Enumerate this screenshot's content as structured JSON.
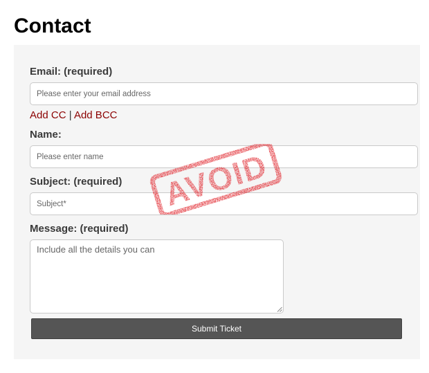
{
  "page": {
    "title": "Contact"
  },
  "form": {
    "email": {
      "label": "Email: (required)",
      "placeholder": "Please enter your email address",
      "value": ""
    },
    "cc_links": {
      "add_cc": "Add CC",
      "separator": "|",
      "add_bcc": "Add BCC"
    },
    "name": {
      "label": "Name:",
      "placeholder": "Please enter name",
      "value": ""
    },
    "subject": {
      "label": "Subject: (required)",
      "placeholder": "Subject*",
      "value": ""
    },
    "message": {
      "label": "Message: (required)",
      "placeholder": "Include all the details you can",
      "value": ""
    },
    "submit_label": "Submit Ticket"
  },
  "stamp": {
    "text": "AVOID",
    "color": "#e01f26"
  },
  "colors": {
    "link": "#8b0000",
    "panel_background": "#f5f5f5",
    "button_background": "#555555"
  }
}
